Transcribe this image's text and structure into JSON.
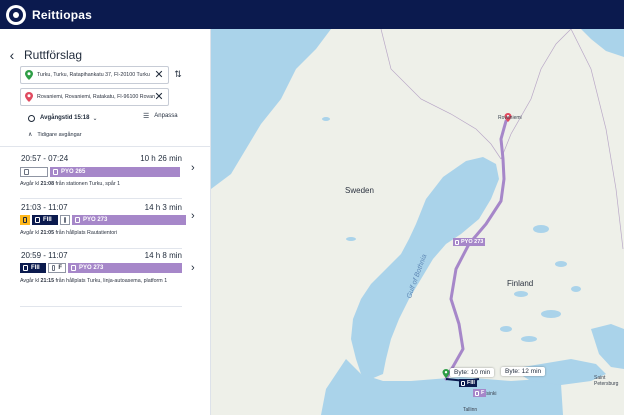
{
  "app": {
    "title": "Reittiopas",
    "logo_icon": "matkahuolto-logo"
  },
  "header": {
    "title": "Ruttförslag",
    "back_icon": "chevron-left-icon"
  },
  "search": {
    "from": {
      "value": "Turku, Turku, Ratapihankatu 37, FI-20100 Turku",
      "pin_color": "#2e9e46"
    },
    "to": {
      "value": "Rovaniemi, Rovaniemi, Ratakatu, FI-96100 Rovaniemi",
      "pin_color": "#e04a5f"
    }
  },
  "options": {
    "departure": "Avgångstid 15:18",
    "adjust": "Anpassa",
    "earlier": "Tidigare avgångar"
  },
  "colors": {
    "bus": "#a687c9",
    "train_dark": "#0b1a4e",
    "accent": "#ffb81c",
    "route_line": "#a687c9"
  },
  "routes": [
    {
      "times": "20:57 - 07:24",
      "duration": "10 h 26 min",
      "legs": [
        {
          "type": "walk",
          "label": ""
        },
        {
          "type": "bus",
          "label": "PYO 265"
        }
      ],
      "info_prefix": "Avgår kl ",
      "info_time": "21:08",
      "info_rest": " från stationen Turku, spår 1"
    },
    {
      "times": "21:03 - 11:07",
      "duration": "14 h 3 min",
      "legs": [
        {
          "type": "accent",
          "label": ""
        },
        {
          "type": "train",
          "label": "FIII"
        },
        {
          "type": "walk",
          "label": ""
        },
        {
          "type": "bus",
          "label": "PYO 273"
        }
      ],
      "info_prefix": "Avgår kl ",
      "info_time": "21:05",
      "info_rest": " från hållplats Rautatientori"
    },
    {
      "times": "20:59 - 11:07",
      "duration": "14 h 8 min",
      "legs": [
        {
          "type": "train",
          "label": "FIII"
        },
        {
          "type": "walk",
          "label": "F"
        },
        {
          "type": "bus",
          "label": "PYO 273"
        }
      ],
      "info_prefix": "Avgår kl ",
      "info_time": "21:15",
      "info_rest": " från hållplats Turku, linja-autoasema, platform 1"
    }
  ],
  "map": {
    "labels": {
      "sweden": "Sweden",
      "finland": "Finland",
      "gulf": "Gulf of Bothnia",
      "rovaniemi": "Rovaniemi",
      "tallinn": "Tallinn",
      "helsinki": "Helsinki",
      "saint_petersburg": "Saint Petersburg"
    },
    "bus_label": "PYO 273",
    "transfer_1": "Byte: 10 min",
    "transfer_2": "Byte: 12 min",
    "train_label": "FIII",
    "walk_label": "F"
  }
}
